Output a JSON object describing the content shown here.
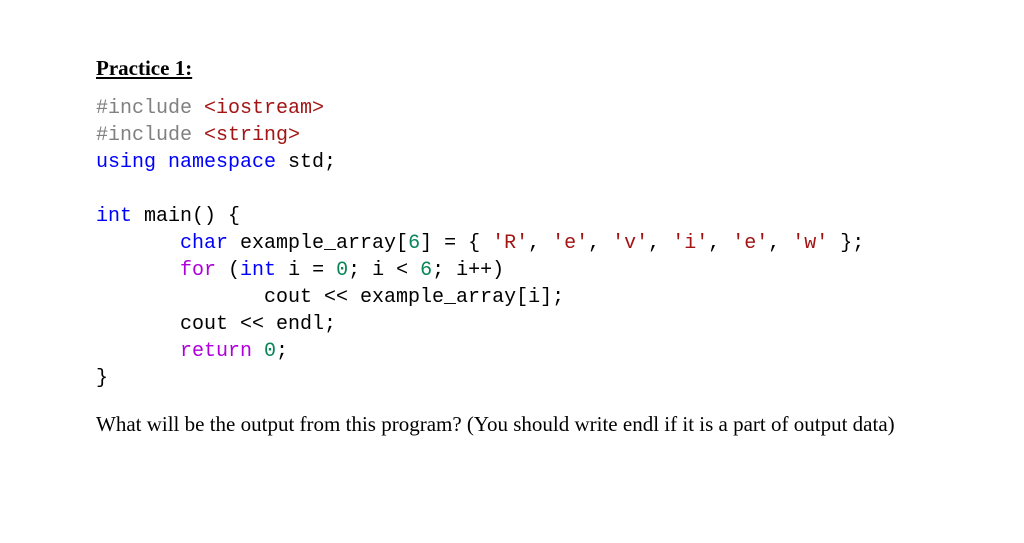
{
  "heading": "Practice 1:",
  "code": {
    "l1": {
      "pre": "#include ",
      "inc": "<iostream>"
    },
    "l2": {
      "pre": "#include ",
      "inc": "<string>"
    },
    "l3": {
      "a": "using ",
      "b": "namespace ",
      "c": "std;"
    },
    "l4": "",
    "l5": {
      "a": "int ",
      "b": "main() {"
    },
    "l6": {
      "a": "       ",
      "b": "char ",
      "c": "example_array[",
      "d": "6",
      "e": "] = { ",
      "s1": "'R'",
      "c1": ", ",
      "s2": "'e'",
      "c2": ", ",
      "s3": "'v'",
      "c3": ", ",
      "s4": "'i'",
      "c4": ", ",
      "s5": "'e'",
      "c5": ", ",
      "s6": "'w'",
      "f": " };"
    },
    "l7": {
      "a": "       ",
      "b": "for ",
      "c": "(",
      "d": "int ",
      "e": "i = ",
      "f": "0",
      "g": "; i < ",
      "h": "6",
      "i": "; i++)"
    },
    "l8": {
      "a": "              cout << example_array[i];"
    },
    "l9": {
      "a": "       cout << endl;"
    },
    "l10": {
      "a": "       ",
      "b": "return ",
      "c": "0",
      "d": ";"
    },
    "l11": "}"
  },
  "question": "What will be the output from this program? (You should write endl if it is a part of output data)"
}
